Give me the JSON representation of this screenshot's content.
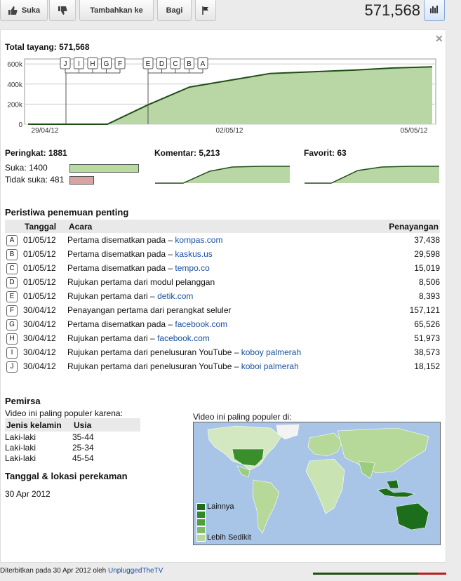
{
  "toolbar": {
    "like_label": "Suka",
    "add_to_label": "Tambahkan ke",
    "share_label": "Bagi",
    "view_count": "571,568"
  },
  "overview": {
    "total_label": "Total tayang: 571,568",
    "y_ticks": [
      "600k",
      "400k",
      "200k",
      "0"
    ],
    "x_ticks": [
      "29/04/12",
      "02/05/12",
      "05/05/12"
    ],
    "markers_left": [
      "J",
      "I",
      "H",
      "G",
      "F"
    ],
    "markers_right": [
      "E",
      "D",
      "C",
      "B",
      "A"
    ]
  },
  "chart_data": {
    "type": "area",
    "title": "Total tayang: 571,568",
    "xlabel": "",
    "ylabel": "",
    "x": [
      "29/04/12",
      "30/04/12",
      "01/05/12",
      "02/05/12",
      "03/05/12",
      "04/05/12",
      "05/05/12",
      "05/05/12 end"
    ],
    "values": [
      0,
      0,
      190000,
      370000,
      505000,
      540000,
      560000,
      571568
    ],
    "ylim": [
      0,
      650000
    ],
    "grid": true,
    "color": "#b9d7a4",
    "line_color": "#1f4f16"
  },
  "ratings": {
    "rating_label": "Peringkat: 1881",
    "likes_label": "Suka: 1400",
    "dislikes_label": "Tidak suka: 481",
    "likes_fraction": 1.0,
    "dislikes_fraction": 0.34,
    "like_color": "#b9dba0",
    "dislike_color": "#d7a3a3",
    "comments_label": "Komentar: 5,213",
    "favorites_label": "Favorit: 63"
  },
  "events": {
    "title": "Peristiwa penemuan penting",
    "col_date": "Tanggal",
    "col_event": "Acara",
    "col_views": "Penayangan",
    "rows": [
      {
        "badge": "A",
        "date": "01/05/12",
        "text": "Pertama disematkan pada – ",
        "link": "kompas.com",
        "views": "37,438"
      },
      {
        "badge": "B",
        "date": "01/05/12",
        "text": "Pertama disematkan pada – ",
        "link": "kaskus.us",
        "views": "29,598"
      },
      {
        "badge": "C",
        "date": "01/05/12",
        "text": "Pertama disematkan pada – ",
        "link": "tempo.co",
        "views": "15,019"
      },
      {
        "badge": "D",
        "date": "01/05/12",
        "text": "Rujukan pertama dari modul pelanggan",
        "link": "",
        "views": "8,506"
      },
      {
        "badge": "E",
        "date": "01/05/12",
        "text": "Rujukan pertama dari – ",
        "link": "detik.com",
        "views": "8,393"
      },
      {
        "badge": "F",
        "date": "30/04/12",
        "text": "Penayangan pertama dari perangkat seluler",
        "link": "",
        "views": "157,121"
      },
      {
        "badge": "G",
        "date": "30/04/12",
        "text": "Pertama disematkan pada – ",
        "link": "facebook.com",
        "views": "65,526"
      },
      {
        "badge": "H",
        "date": "30/04/12",
        "text": "Rujukan pertama dari – ",
        "link": "facebook.com",
        "views": "51,973"
      },
      {
        "badge": "I",
        "date": "30/04/12",
        "text": "Rujukan pertama dari penelusuran YouTube – ",
        "link": "koboy palmerah",
        "views": "38,573"
      },
      {
        "badge": "J",
        "date": "30/04/12",
        "text": "Rujukan pertama dari penelusuran YouTube – ",
        "link": "koboi palmerah",
        "views": "18,152"
      }
    ]
  },
  "audience": {
    "title": "Pemirsa",
    "popular_because": "Video ini paling populer karena:",
    "col_gender": "Jenis kelamin",
    "col_age": "Usia",
    "rows": [
      {
        "gender": "Laki-laki",
        "age": "35-44"
      },
      {
        "gender": "Laki-laki",
        "age": "25-34"
      },
      {
        "gender": "Laki-laki",
        "age": "45-54"
      }
    ],
    "recording_title": "Tanggal & lokasi perekaman",
    "recording_date": "30 Apr 2012",
    "map_title": "Video ini paling populer di:",
    "legend_more": "Lainnya",
    "legend_less": "Lebih Sedikit"
  },
  "footer": {
    "published": "Diterbitkan pada 30 Apr 2012 oleh ",
    "channel": "UnpluggedTheTV"
  }
}
